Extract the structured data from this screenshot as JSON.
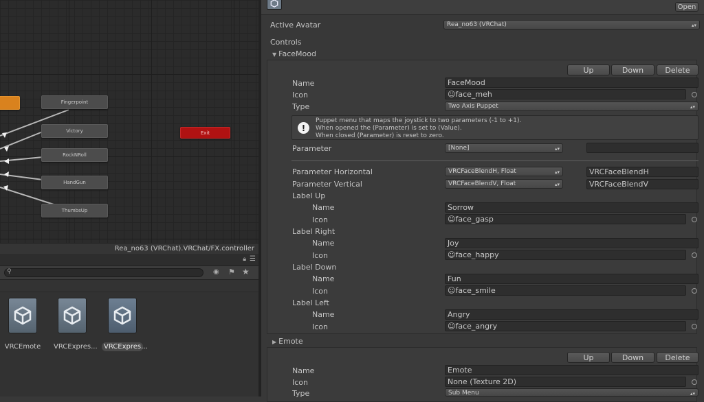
{
  "graph": {
    "nodes": [
      "Fingerpoint",
      "Victory",
      "RockNRoll",
      "HandGun",
      "ThumbsUp",
      "Exit"
    ],
    "footer_path": "Rea_no63 (VRChat).VRChat/FX.controller"
  },
  "project": {
    "assets": [
      "VRCEmote",
      "VRCExpres...",
      "VRCExpres..."
    ],
    "search_placeholder": ""
  },
  "inspector": {
    "open_label": "Open",
    "active_avatar_label": "Active Avatar",
    "active_avatar_value": "Rea_no63 (VRChat)",
    "controls_label": "Controls",
    "control1": {
      "header": "FaceMood",
      "up": "Up",
      "down": "Down",
      "delete": "Delete",
      "name_label": "Name",
      "name_value": "FaceMood",
      "icon_label": "Icon",
      "icon_value": "face_meh",
      "type_label": "Type",
      "type_value": "Two Axis Puppet",
      "help_text": "Puppet menu that maps the joystick to two parameters (-1 to +1).\nWhen opened the (Parameter) is set to (Value).\nWhen closed (Parameter) is reset to zero.",
      "parameter_label": "Parameter",
      "parameter_value": "[None]",
      "param_h_label": "Parameter Horizontal",
      "param_h_dropdown": "VRCFaceBlendH, Float",
      "param_h_value": "VRCFaceBlendH",
      "param_v_label": "Parameter Vertical",
      "param_v_dropdown": "VRCFaceBlendV, Float",
      "param_v_value": "VRCFaceBlendV",
      "label_up": "Label Up",
      "up_name": "Sorrow",
      "up_icon": "face_gasp",
      "label_right": "Label Right",
      "right_name": "Joy",
      "right_icon": "face_happy",
      "label_down": "Label Down",
      "down_name": "Fun",
      "down_icon": "face_smile",
      "label_left": "Label Left",
      "left_name": "Angry",
      "left_icon": "face_angry",
      "sub_name_label": "Name",
      "sub_icon_label": "Icon"
    },
    "control2": {
      "header": "Emote",
      "up": "Up",
      "down": "Down",
      "delete": "Delete",
      "name_label": "Name",
      "name_value": "Emote",
      "icon_label": "Icon",
      "icon_value": "None (Texture 2D)",
      "type_label": "Type",
      "type_value": "Sub Menu"
    }
  }
}
